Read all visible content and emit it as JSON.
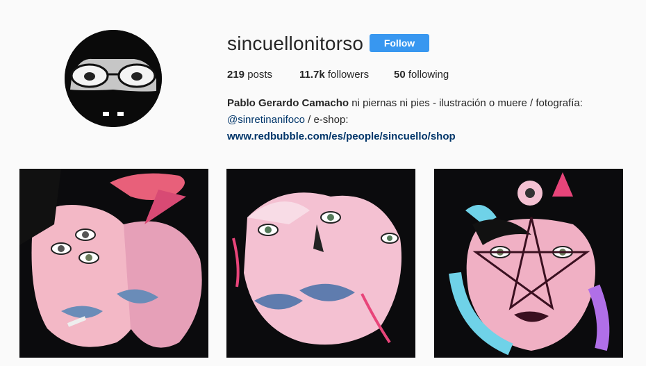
{
  "profile": {
    "username": "sincuellonitorso",
    "follow_label": "Follow",
    "stats": {
      "posts_count": "219",
      "posts_label": " posts",
      "followers_count": "11.7k",
      "followers_label": " followers",
      "following_count": "50",
      "following_label": " following"
    },
    "bio": {
      "full_name": "Pablo Gerardo Camacho",
      "text": " ni piernas ni pies - ilustración o muere / fotografía:",
      "mention": "@sinretinanifoco",
      "text2": " / e-shop:",
      "link": "www.redbubble.com/es/people/sincuello/shop"
    }
  },
  "colors": {
    "follow_button": "#3897f0",
    "link": "#003569",
    "background": "#fafafa"
  },
  "posts": [
    {
      "name": "post-1"
    },
    {
      "name": "post-2"
    },
    {
      "name": "post-3"
    }
  ]
}
